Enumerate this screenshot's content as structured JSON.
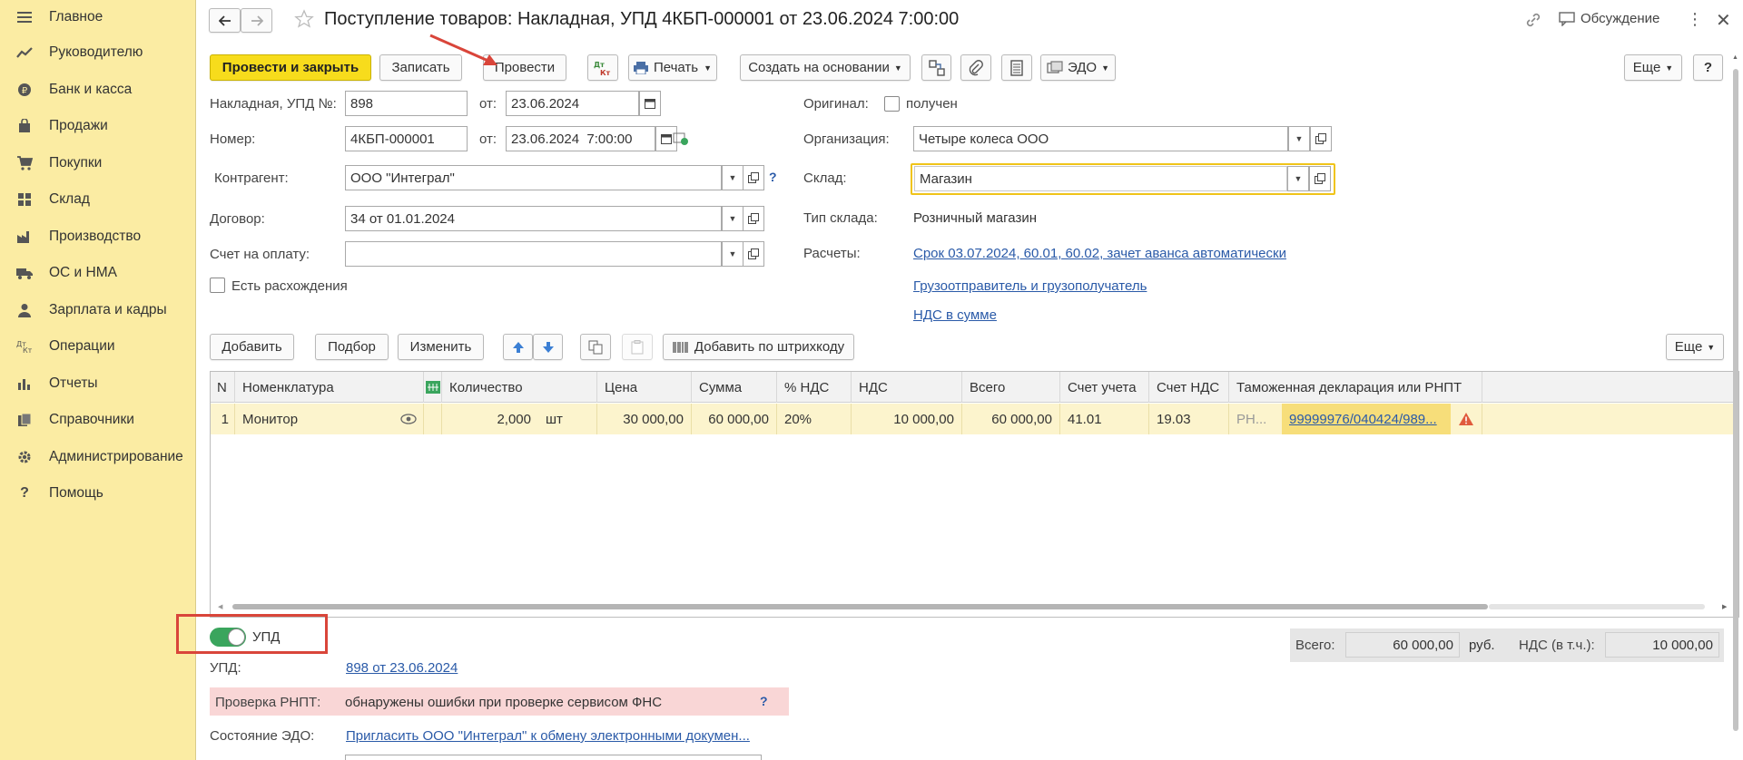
{
  "sidebar": {
    "items": [
      {
        "label": "Главное",
        "icon": "menu-icon"
      },
      {
        "label": "Руководителю",
        "icon": "trend-icon"
      },
      {
        "label": "Банк и касса",
        "icon": "coin-icon"
      },
      {
        "label": "Продажи",
        "icon": "bag-icon"
      },
      {
        "label": "Покупки",
        "icon": "cart-icon"
      },
      {
        "label": "Склад",
        "icon": "warehouse-icon"
      },
      {
        "label": "Производство",
        "icon": "factory-icon"
      },
      {
        "label": "ОС и НМА",
        "icon": "truck-icon"
      },
      {
        "label": "Зарплата и кадры",
        "icon": "person-icon"
      },
      {
        "label": "Операции",
        "icon": "dt-kt-icon"
      },
      {
        "label": "Отчеты",
        "icon": "bar-chart-icon"
      },
      {
        "label": "Справочники",
        "icon": "books-icon"
      },
      {
        "label": "Администрирование",
        "icon": "gear-icon"
      },
      {
        "label": "Помощь",
        "icon": "question-icon"
      }
    ]
  },
  "header": {
    "title": "Поступление товаров: Накладная, УПД 4КБП-000001 от 23.06.2024 7:00:00",
    "discussion": "Обсуждение"
  },
  "toolbar": {
    "post_close": "Провести и закрыть",
    "save": "Записать",
    "post": "Провести",
    "dtkt": "Дт Кт",
    "print": "Печать",
    "create_based": "Создать на основании",
    "edo": "ЭДО",
    "more": "Еще",
    "help": "?"
  },
  "form": {
    "invoice_label": "Накладная, УПД №:",
    "invoice_value": "898",
    "from1": "от:",
    "invoice_date": "23.06.2024",
    "number_label": "Номер:",
    "number_value": "4КБП-000001",
    "from2": "от:",
    "number_date": "23.06.2024  7:00:00",
    "counterparty_label": "Контрагент:",
    "counterparty_value": "ООО \"Интеграл\"",
    "contract_label": "Договор:",
    "contract_value": "34 от 01.01.2024",
    "payment_label": "Счет на оплату:",
    "payment_value": "",
    "discrepancy_label": "Есть расхождения",
    "original_label": "Оригинал:",
    "original_check": "получен",
    "org_label": "Организация:",
    "org_value": "Четыре колеса ООО",
    "warehouse_label": "Склад:",
    "warehouse_value": "Магазин",
    "wh_type_label": "Тип склада:",
    "wh_type_value": "Розничный магазин",
    "settlements_label": "Расчеты:",
    "settlements_link": "Срок 03.07.2024, 60.01, 60.02, зачет аванса автоматически",
    "shipper_link": "Грузоотправитель и грузополучатель",
    "vat_link": "НДС в сумме",
    "q_mark": "?"
  },
  "table_toolbar": {
    "add": "Добавить",
    "pick": "Подбор",
    "change": "Изменить",
    "barcode": "Добавить по штрихкоду",
    "more": "Еще"
  },
  "table": {
    "columns": [
      "N",
      "Номенклатура",
      "Количество",
      "Цена",
      "Сумма",
      "% НДС",
      "НДС",
      "Всего",
      "Счет учета",
      "Счет НДС",
      "Таможенная декларация или РНПТ"
    ],
    "rows": [
      {
        "n": "1",
        "name": "Монитор",
        "qty": "2,000",
        "unit": "шт",
        "price": "30 000,00",
        "sum": "60 000,00",
        "vat_rate": "20%",
        "vat": "10 000,00",
        "total": "60 000,00",
        "account": "41.01",
        "vat_account": "19.03",
        "customs_prefix": "РН...",
        "customs": "99999976/040424/989..."
      }
    ]
  },
  "footer": {
    "upd_toggle": "УПД",
    "upd_label": "УПД:",
    "upd_link": "898 от 23.06.2024",
    "check_label": "Проверка РНПТ:",
    "check_value": "обнаружены ошибки при проверке сервисом ФНС",
    "check_q": "?",
    "edo_label": "Состояние ЭДО:",
    "edo_link": "Пригласить ООО \"Интеграл\" к обмену электронными докумен...",
    "total_label": "Всего:",
    "total_value": "60 000,00",
    "currency": "руб.",
    "vat_label": "НДС (в т.ч.):",
    "vat_value": "10 000,00"
  },
  "colors": {
    "sidebar_bg": "#fbeca3",
    "primary_button": "#f7dc1c",
    "link": "#2a5aa8",
    "annotation_red": "#d9453a",
    "error_bg": "#f9d6d6",
    "selected_row": "#fcf4cd",
    "toggle_on": "#3aa55d"
  }
}
